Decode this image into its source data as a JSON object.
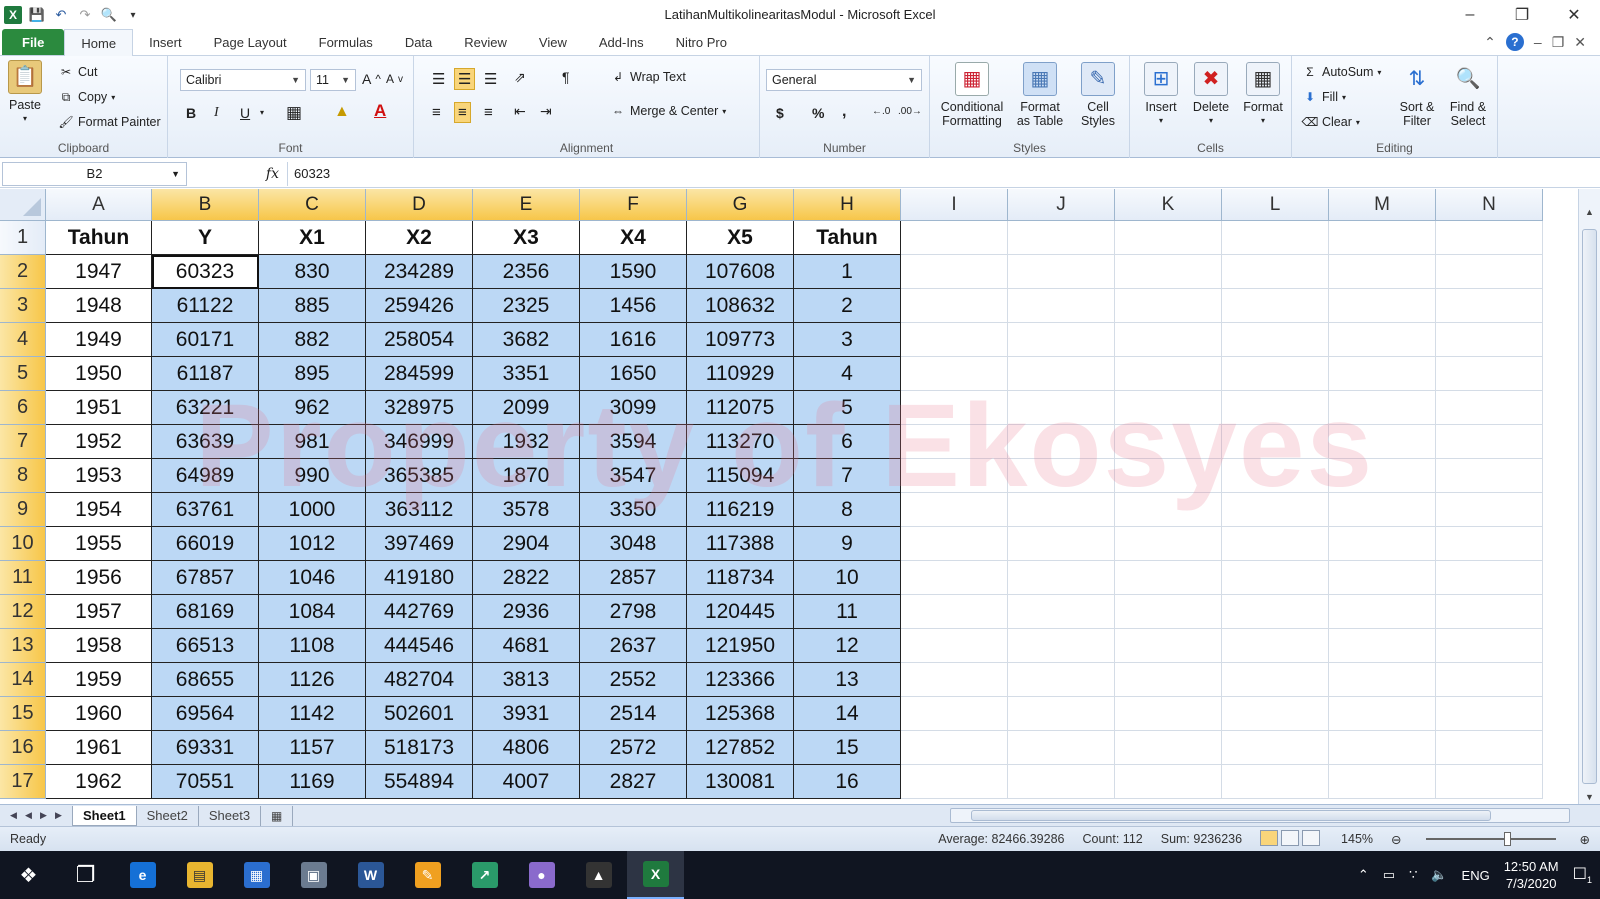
{
  "window": {
    "title": "LatihanMultikolinearitasModul  -  Microsoft Excel"
  },
  "tabs": [
    "File",
    "Home",
    "Insert",
    "Page Layout",
    "Formulas",
    "Data",
    "Review",
    "View",
    "Add-Ins",
    "Nitro Pro"
  ],
  "ribbon": {
    "clipboard": {
      "paste": "Paste",
      "cut": "Cut",
      "copy": "Copy",
      "format_painter": "Format Painter",
      "label": "Clipboard"
    },
    "font": {
      "name": "Calibri",
      "size": "11",
      "label": "Font",
      "bold": "B",
      "italic": "I",
      "underline": "U"
    },
    "alignment": {
      "wrap_text": "Wrap Text",
      "merge_center": "Merge & Center",
      "label": "Alignment"
    },
    "number": {
      "format": "General",
      "currency": "$",
      "percent": "%",
      "comma": ",",
      "label": "Number"
    },
    "styles": {
      "conditional": "Conditional",
      "conditional2": "Formatting",
      "format_table": "Format",
      "format_table2": "as Table",
      "cell_styles": "Cell",
      "cell_styles2": "Styles",
      "label": "Styles"
    },
    "cells": {
      "insert": "Insert",
      "delete": "Delete",
      "format": "Format",
      "label": "Cells"
    },
    "editing": {
      "autosum": "AutoSum",
      "fill": "Fill",
      "clear": "Clear",
      "sort": "Sort &",
      "sort2": "Filter",
      "find": "Find &",
      "find2": "Select",
      "label": "Editing"
    }
  },
  "formula_bar": {
    "name_box": "B2",
    "fx": "fx",
    "value": "60323"
  },
  "columns": [
    "A",
    "B",
    "C",
    "D",
    "E",
    "F",
    "G",
    "H",
    "I",
    "J",
    "K",
    "L",
    "M",
    "N"
  ],
  "selected_columns": [
    "B",
    "C",
    "D",
    "E",
    "F",
    "G",
    "H"
  ],
  "header_row": [
    "Tahun",
    "Y",
    "X1",
    "X2",
    "X3",
    "X4",
    "X5",
    "Tahun"
  ],
  "data_rows": [
    [
      "1947",
      "60323",
      "830",
      "234289",
      "2356",
      "1590",
      "107608",
      "1"
    ],
    [
      "1948",
      "61122",
      "885",
      "259426",
      "2325",
      "1456",
      "108632",
      "2"
    ],
    [
      "1949",
      "60171",
      "882",
      "258054",
      "3682",
      "1616",
      "109773",
      "3"
    ],
    [
      "1950",
      "61187",
      "895",
      "284599",
      "3351",
      "1650",
      "110929",
      "4"
    ],
    [
      "1951",
      "63221",
      "962",
      "328975",
      "2099",
      "3099",
      "112075",
      "5"
    ],
    [
      "1952",
      "63639",
      "981",
      "346999",
      "1932",
      "3594",
      "113270",
      "6"
    ],
    [
      "1953",
      "64989",
      "990",
      "365385",
      "1870",
      "3547",
      "115094",
      "7"
    ],
    [
      "1954",
      "63761",
      "1000",
      "363112",
      "3578",
      "3350",
      "116219",
      "8"
    ],
    [
      "1955",
      "66019",
      "1012",
      "397469",
      "2904",
      "3048",
      "117388",
      "9"
    ],
    [
      "1956",
      "67857",
      "1046",
      "419180",
      "2822",
      "2857",
      "118734",
      "10"
    ],
    [
      "1957",
      "68169",
      "1084",
      "442769",
      "2936",
      "2798",
      "120445",
      "11"
    ],
    [
      "1958",
      "66513",
      "1108",
      "444546",
      "4681",
      "2637",
      "121950",
      "12"
    ],
    [
      "1959",
      "68655",
      "1126",
      "482704",
      "3813",
      "2552",
      "123366",
      "13"
    ],
    [
      "1960",
      "69564",
      "1142",
      "502601",
      "3931",
      "2514",
      "125368",
      "14"
    ],
    [
      "1961",
      "69331",
      "1157",
      "518173",
      "4806",
      "2572",
      "127852",
      "15"
    ],
    [
      "1962",
      "70551",
      "1169",
      "554894",
      "4007",
      "2827",
      "130081",
      "16"
    ]
  ],
  "watermark": "Property of Ekosyes",
  "sheets": [
    "Sheet1",
    "Sheet2",
    "Sheet3"
  ],
  "status": {
    "ready": "Ready",
    "average": "Average: 82466.39286",
    "count": "Count: 112",
    "sum": "Sum: 9236236",
    "zoom": "145%"
  },
  "taskbar": {
    "lang": "ENG",
    "time": "12:50 AM",
    "date": "7/3/2020",
    "notifications": "1"
  }
}
